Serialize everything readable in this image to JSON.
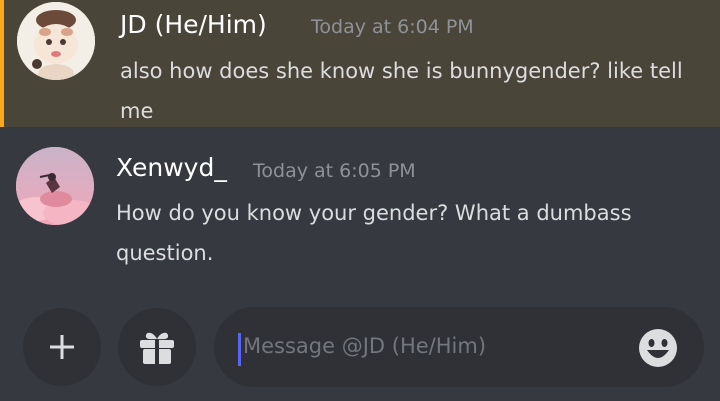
{
  "messages": [
    {
      "username": "JD (He/Him)",
      "timestamp": "Today at 6:04 PM",
      "text": "also how does she know she is bunnygender? like tell me",
      "highlighted": true,
      "highlight_color": "#faa81a"
    },
    {
      "username": "Xenwyd_",
      "timestamp": "Today at 6:05 PM",
      "text": "How do you know your gender? What a dumbass question."
    }
  ],
  "composer": {
    "placeholder": "Message @JD (He/Him)",
    "add_icon": "plus-icon",
    "gift_icon": "gift-icon",
    "emoji_icon": "emoji-icon"
  },
  "colors": {
    "background": "#36393f",
    "input_background": "#2f3136",
    "mention_highlight": "#4a4539",
    "accent": "#5865f2"
  }
}
